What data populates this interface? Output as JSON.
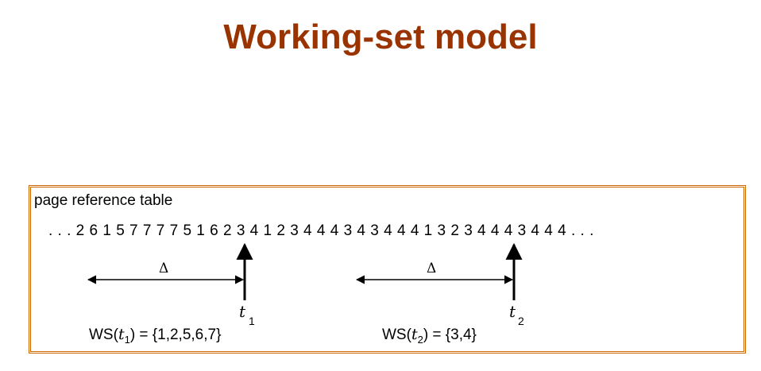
{
  "title": "Working-set model",
  "figure": {
    "label": "page reference table",
    "reference_string": ". . . 2 6 1 5 7 7 7 7 5 1 6 2 3 4 1 2 3 4 4 4 3 4 3 4 4 4 1 3 2 3 4 4 4 3 4 4 4 . . .",
    "delta_symbol": "Δ",
    "windows": [
      {
        "time_label": "t",
        "time_sub": "1",
        "ws_prefix": "WS(",
        "ws_var": "t",
        "ws_sub": "1",
        "ws_suffix": ") = {1,2,5,6,7}"
      },
      {
        "time_label": "t",
        "time_sub": "2",
        "ws_prefix": "WS(",
        "ws_var": "t",
        "ws_sub": "2",
        "ws_suffix": ") = {3,4}"
      }
    ]
  },
  "colors": {
    "title": "#993300",
    "border": "#cc6600"
  }
}
